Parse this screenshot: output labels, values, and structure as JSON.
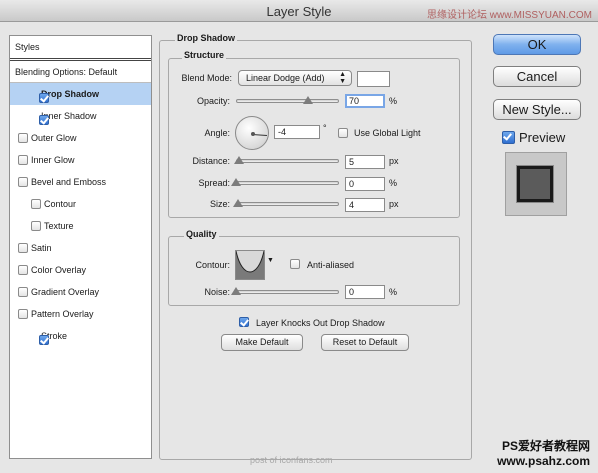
{
  "window": {
    "title": "Layer Style",
    "watermark_top": "思缘设计论坛 www.MISSYUAN.COM"
  },
  "styles_list": {
    "header": "Styles",
    "blending_options": "Blending Options: Default",
    "items": [
      {
        "label": "Drop Shadow",
        "checked": true,
        "selected": true,
        "indent": false
      },
      {
        "label": "Inner Shadow",
        "checked": true,
        "selected": false,
        "indent": false
      },
      {
        "label": "Outer Glow",
        "checked": false,
        "selected": false,
        "indent": false
      },
      {
        "label": "Inner Glow",
        "checked": false,
        "selected": false,
        "indent": false
      },
      {
        "label": "Bevel and Emboss",
        "checked": false,
        "selected": false,
        "indent": false
      },
      {
        "label": "Contour",
        "checked": false,
        "selected": false,
        "indent": true
      },
      {
        "label": "Texture",
        "checked": false,
        "selected": false,
        "indent": true
      },
      {
        "label": "Satin",
        "checked": false,
        "selected": false,
        "indent": false
      },
      {
        "label": "Color Overlay",
        "checked": false,
        "selected": false,
        "indent": false
      },
      {
        "label": "Gradient Overlay",
        "checked": false,
        "selected": false,
        "indent": false
      },
      {
        "label": "Pattern Overlay",
        "checked": false,
        "selected": false,
        "indent": false
      },
      {
        "label": "Stroke",
        "checked": true,
        "selected": false,
        "indent": false
      }
    ]
  },
  "panel": {
    "title": "Drop Shadow",
    "structure": {
      "label": "Structure",
      "blend_mode_label": "Blend Mode:",
      "blend_mode_value": "Linear Dodge (Add)",
      "opacity_label": "Opacity:",
      "opacity_value": "70",
      "opacity_unit": "%",
      "opacity_level": 0.7,
      "angle_label": "Angle:",
      "angle_value": "-4",
      "angle_unit": "°",
      "use_global_light_label": "Use Global Light",
      "use_global_light": false,
      "distance_label": "Distance:",
      "distance_value": "5",
      "distance_unit": "px",
      "spread_label": "Spread:",
      "spread_value": "0",
      "spread_unit": "%",
      "size_label": "Size:",
      "size_value": "4",
      "size_unit": "px"
    },
    "quality": {
      "label": "Quality",
      "contour_label": "Contour:",
      "anti_aliased_label": "Anti-aliased",
      "anti_aliased": false,
      "noise_label": "Noise:",
      "noise_value": "0",
      "noise_unit": "%"
    },
    "layer_knocks_out_label": "Layer Knocks Out Drop Shadow",
    "layer_knocks_out": true,
    "make_default_label": "Make Default",
    "reset_default_label": "Reset to Default"
  },
  "buttons": {
    "ok": "OK",
    "cancel": "Cancel",
    "new_style": "New Style...",
    "preview_label": "Preview",
    "preview_checked": true
  },
  "watermarks": {
    "bottom_center": "post of iconfans.com",
    "bottom_right_1": "PS爱好者教程网",
    "bottom_right_2": "www.psahz.com"
  }
}
